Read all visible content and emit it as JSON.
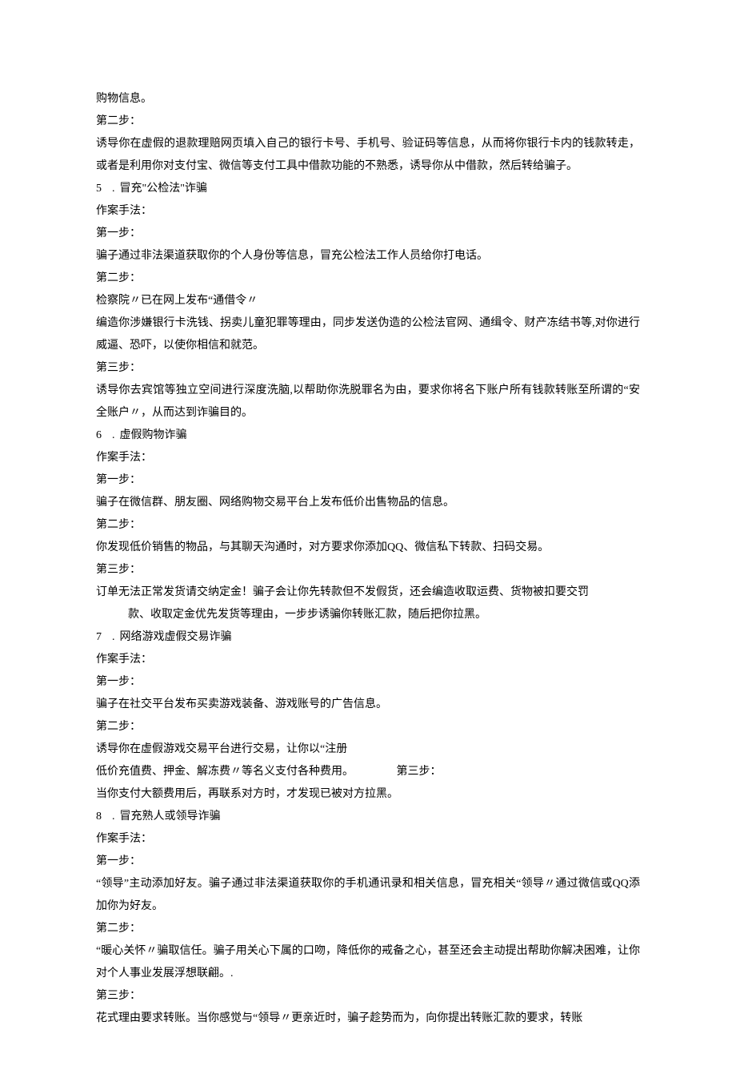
{
  "lines": {
    "l1": "购物信息。",
    "l2": "第二步：",
    "l3": "诱导你在虚假的退款理赔网页填入自己的银行卡号、手机号、验证码等信息，从而将你银行卡内的钱款转走，或者是利用你对支付宝、微信等支付工具中借款功能的不熟悉，诱导你从中借款，然后转给骗子。",
    "n5": "5",
    "t5": "冒充\"公检法\"诈骗",
    "l4": "作案手法：",
    "l5": "第一步：",
    "l6": "骗子通过非法渠道获取你的个人身份等信息，冒充公检法工作人员给你打电话。",
    "l7": "第二步：",
    "l8": "检察院〃已在网上发布“通借令〃",
    "l9": "编造你涉嫌银行卡洗钱、拐卖儿童犯罪等理由，同步发送伪造的公检法官网、通缉令、财产冻结书等,对你进行威逼、恐吓，以使你相信和就范。",
    "l10": "第三步：",
    "l11": "诱导你去宾馆等独立空间进行深度洗脑,以帮助你洗脱罪名为由，要求你将名下账户所有钱款转账至所谓的“安全账户〃，从而达到诈骗目的。",
    "n6": "6",
    "t6": "虚假购物诈骗",
    "l12": "作案手法：",
    "l13": "第一步：",
    "l14": "骗子在微信群、朋友圈、网络购物交易平台上发布低价出售物品的信息。",
    "l15": "第二步：",
    "l16": "你发现低价销售的物品，与其聊天沟通时，对方要求你添加QQ、微信私下转款、扫码交易。",
    "l17": "第三步：",
    "l18": "订单无法正常发货请交纳定金！骗子会让你先转款但不发假货，还会编造收取运费、货物被扣要交罚",
    "l18b": "款、收取定金优先发货等理由，一步步诱骗你转账汇款，随后把你拉黑。",
    "n7": "7",
    "t7": "网络游戏虚假交易诈骗",
    "l19": "作案手法：",
    "l20": "第一步：",
    "l21": "骗子在社交平台发布买卖游戏装备、游戏账号的广告信息。",
    "l22": "第二步：",
    "l23": "诱导你在虚假游戏交易平台进行交易，让你以“注册",
    "l24a": "低价充值费、押金、解冻费〃等名义支付各种费用。",
    "l24b": "第三步：",
    "l25": "当你支付大额费用后，再联系对方时，才发现已被对方拉黑。",
    "n8": "8",
    "t8": "冒充熟人或领导诈骗",
    "l26": "作案手法：",
    "l27": "第一步：",
    "l28": "“领导”主动添加好友。骗子通过非法渠道获取你的手机通讯录和相关信息，冒充相关“领导〃通过微信或QQ添加你为好友。",
    "l29": "第二步：",
    "l30": "“暖心关怀〃骗取信任。骗子用关心下属的口吻，降低你的戒备之心，甚至还会主动提出帮助你解决困难，让你对个人事业发展浮想联翩。.",
    "l31": "第三步：",
    "l32": "花式理由要求转账。当你感觉与“领导〃更亲近时，骗子趁势而为，向你提出转账汇款的要求，转账"
  },
  "dot": "."
}
